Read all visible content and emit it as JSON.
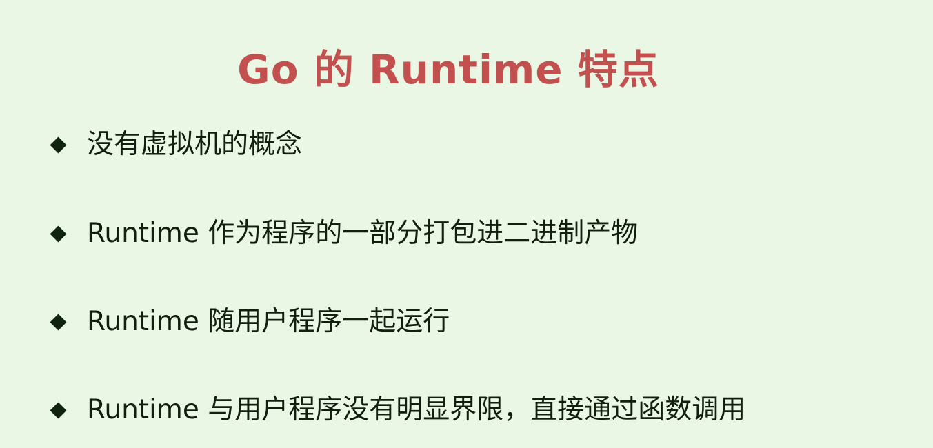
{
  "slide": {
    "title": "Go 的 Runtime 特点",
    "bullet_icon": "diamond-bullet-icon",
    "colors": {
      "background": "#e9f7e4",
      "title": "#c2504f",
      "text": "#111e10",
      "bullet": "#10230f"
    },
    "bullets": [
      {
        "text": "没有虚拟机的概念"
      },
      {
        "text": "Runtime 作为程序的一部分打包进二进制产物"
      },
      {
        "text": "Runtime 随用户程序一起运行"
      },
      {
        "text": "Runtime 与用户程序没有明显界限，直接通过函数调用"
      }
    ]
  }
}
